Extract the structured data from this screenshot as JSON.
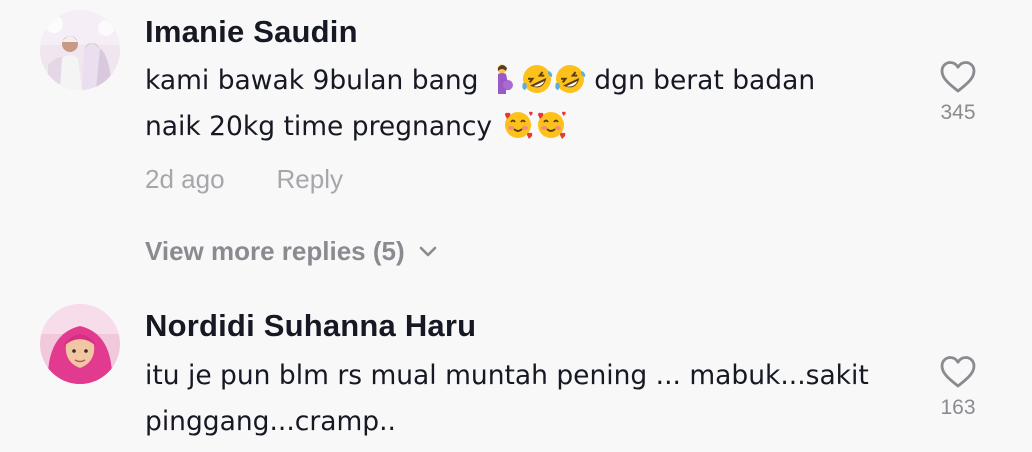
{
  "comments": [
    {
      "username": "Imanie Saudin",
      "text_1": "kami bawak 9bulan bang ",
      "text_2": " dgn berat badan",
      "text_3": "naik 20kg time pregnancy ",
      "emojis_line1": [
        "pregnant-woman-emoji",
        "rolling-laughing-emoji",
        "rolling-laughing-emoji"
      ],
      "emojis_line2": [
        "smiling-hearts-emoji",
        "smiling-hearts-emoji"
      ],
      "time": "2d ago",
      "reply_label": "Reply",
      "view_more": "View more replies (5)",
      "likes": "345"
    },
    {
      "username": "Nordidi Suhanna Haru",
      "text_1": "itu je pun blm rs mual muntah pening ... mabuk...sakit",
      "text_2": "pinggang...cramp..",
      "likes": "163"
    }
  ],
  "colors": {
    "background": "#f8f8f8",
    "username": "#161823",
    "meta": "#a6a7ab",
    "like_icon": "#8a8b91"
  }
}
